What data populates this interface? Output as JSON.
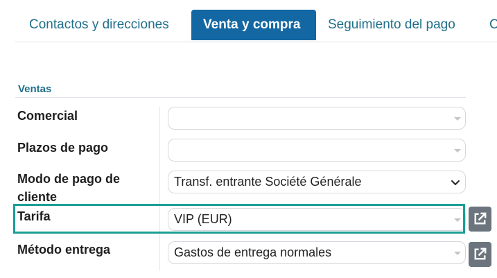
{
  "tabs": [
    {
      "label": "Contactos y direcciones",
      "active": false
    },
    {
      "label": "Venta y compra",
      "active": true
    },
    {
      "label": "Seguimiento del pago",
      "active": false
    },
    {
      "label": "C",
      "active": false
    }
  ],
  "section": {
    "title": "Ventas"
  },
  "fields": {
    "comercial": {
      "label": "Comercial",
      "value": ""
    },
    "plazos": {
      "label": "Plazos de pago",
      "value": ""
    },
    "modo_pago": {
      "label_line1": "Modo de pago de",
      "label_line2": "cliente",
      "value": "Transf. entrante Société Générale"
    },
    "tarifa": {
      "label": "Tarifa",
      "value": "VIP (EUR)"
    },
    "metodo": {
      "label": "Método entrega",
      "value": "Gastos de entrega normales"
    }
  },
  "icons": {
    "external": "external-link-icon"
  },
  "colors": {
    "active_tab": "#1368a3",
    "tab_text": "#1f6f8b",
    "highlight": "#1a9e94",
    "ext_button": "#6c757d"
  }
}
